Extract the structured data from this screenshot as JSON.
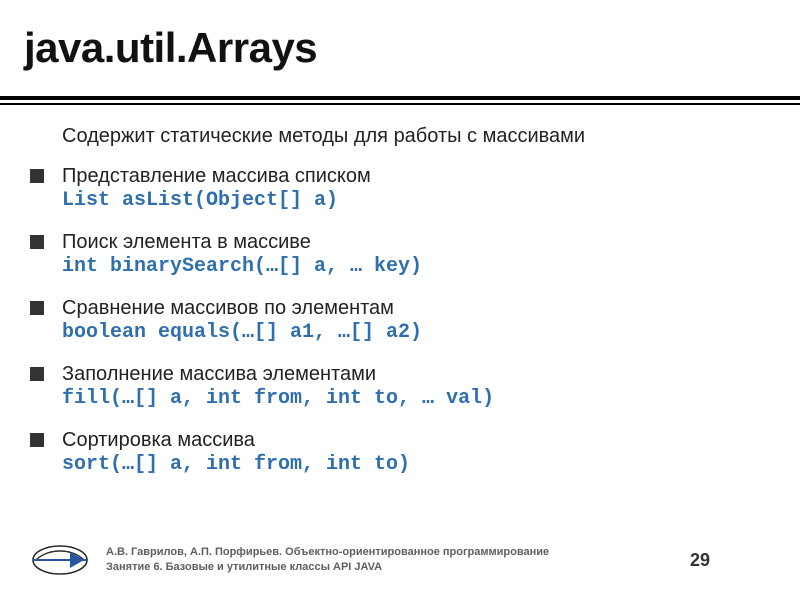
{
  "title": "java.util.Arrays",
  "lead": "Содержит статические методы для работы с массивами",
  "items": [
    {
      "desc": "Представление массива списком",
      "code": "List asList(Object[] a)"
    },
    {
      "desc": "Поиск элемента в массиве",
      "code": "int binarySearch(…[] a, … key)"
    },
    {
      "desc": "Сравнение массивов по элементам",
      "code": "boolean equals(…[] a1, …[] a2)"
    },
    {
      "desc": "Заполнение массива элементами",
      "code": "fill(…[] a, int from, int to, … val)"
    },
    {
      "desc": "Сортировка массива",
      "code": "sort(…[] a, int from, int to)"
    }
  ],
  "footer": {
    "line1": "А.В. Гаврилов, А.П. Порфирьев. Объектно-ориентированное программирование",
    "line2": "Занятие 6. Базовые и утилитные классы API JAVA",
    "page": "29"
  }
}
